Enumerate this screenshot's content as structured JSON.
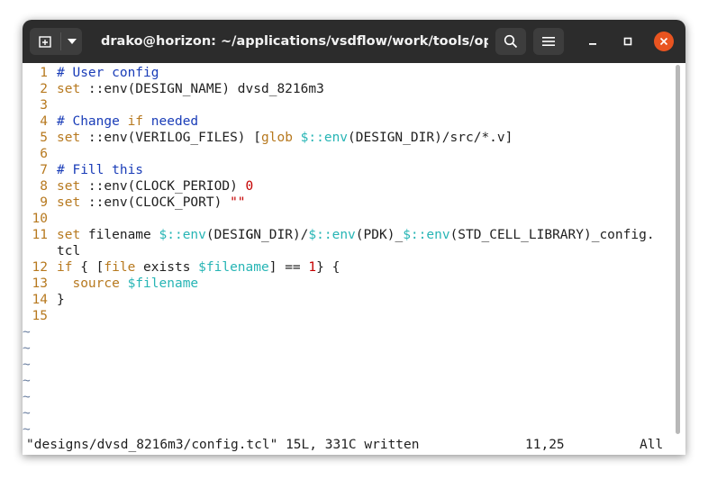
{
  "window": {
    "title": "drako@horizon: ~/applications/vsdflow/work/tools/open...",
    "icons": {
      "new_tab": "new-tab-icon",
      "tab_menu": "chevron-down-icon",
      "search": "search-icon",
      "menu": "hamburger-icon",
      "minimize": "minimize-icon",
      "maximize": "maximize-icon",
      "close": "close-icon"
    }
  },
  "editor": {
    "lines": [
      {
        "n": "1",
        "parts": [
          {
            "t": "# User config",
            "c": "comment"
          }
        ]
      },
      {
        "n": "2",
        "parts": [
          {
            "t": "set",
            "c": "kw"
          },
          {
            "t": " ::env(DESIGN_NAME) dvsd_8216m3",
            "c": "text"
          }
        ]
      },
      {
        "n": "3",
        "parts": []
      },
      {
        "n": "4",
        "parts": [
          {
            "t": "# Change ",
            "c": "comment"
          },
          {
            "t": "if",
            "c": "kw"
          },
          {
            "t": " needed",
            "c": "comment"
          }
        ]
      },
      {
        "n": "5",
        "parts": [
          {
            "t": "set",
            "c": "kw"
          },
          {
            "t": " ::env(VERILOG_FILES) [",
            "c": "text"
          },
          {
            "t": "glob",
            "c": "kw"
          },
          {
            "t": " ",
            "c": "text"
          },
          {
            "t": "$::env",
            "c": "var"
          },
          {
            "t": "(DESIGN_DIR)/src/*.v]",
            "c": "text"
          }
        ]
      },
      {
        "n": "6",
        "parts": []
      },
      {
        "n": "7",
        "parts": [
          {
            "t": "# Fill this",
            "c": "comment"
          }
        ]
      },
      {
        "n": "8",
        "parts": [
          {
            "t": "set",
            "c": "kw"
          },
          {
            "t": " ::env(CLOCK_PERIOD) ",
            "c": "text"
          },
          {
            "t": "0",
            "c": "num"
          }
        ]
      },
      {
        "n": "9",
        "parts": [
          {
            "t": "set",
            "c": "kw"
          },
          {
            "t": " ::env(CLOCK_PORT) ",
            "c": "text"
          },
          {
            "t": "\"\"",
            "c": "num"
          }
        ]
      },
      {
        "n": "10",
        "parts": []
      },
      {
        "n": "11",
        "parts": [
          {
            "t": "set",
            "c": "kw"
          },
          {
            "t": " filename ",
            "c": "text"
          },
          {
            "t": "$::env",
            "c": "var"
          },
          {
            "t": "(DESI",
            "c": "text"
          },
          {
            "t": "G",
            "c": "cursor"
          },
          {
            "t": "N_DIR)/",
            "c": "text"
          },
          {
            "t": "$::env",
            "c": "var"
          },
          {
            "t": "(PDK)_",
            "c": "text"
          },
          {
            "t": "$::env",
            "c": "var"
          },
          {
            "t": "(STD_CELL_LIBRARY)_config.",
            "c": "text"
          }
        ]
      },
      {
        "n": "",
        "parts": [
          {
            "t": "tcl",
            "c": "text"
          }
        ]
      },
      {
        "n": "12",
        "parts": [
          {
            "t": "if",
            "c": "kw"
          },
          {
            "t": " { [",
            "c": "text"
          },
          {
            "t": "file",
            "c": "kw"
          },
          {
            "t": " exists ",
            "c": "text"
          },
          {
            "t": "$filename",
            "c": "var"
          },
          {
            "t": "] == ",
            "c": "text"
          },
          {
            "t": "1",
            "c": "num"
          },
          {
            "t": "} {",
            "c": "text"
          }
        ]
      },
      {
        "n": "13",
        "parts": [
          {
            "t": "  ",
            "c": "text"
          },
          {
            "t": "source",
            "c": "kw"
          },
          {
            "t": " ",
            "c": "text"
          },
          {
            "t": "$filename",
            "c": "var"
          }
        ]
      },
      {
        "n": "14",
        "parts": [
          {
            "t": "}",
            "c": "text"
          }
        ]
      },
      {
        "n": "15",
        "parts": []
      }
    ],
    "tildes": [
      "~",
      "~",
      "~",
      "~",
      "~",
      "~",
      "~"
    ],
    "status": "\"designs/dvsd_8216m3/config.tcl\" 15L, 331C written",
    "position": "11,25",
    "scroll": "All"
  }
}
